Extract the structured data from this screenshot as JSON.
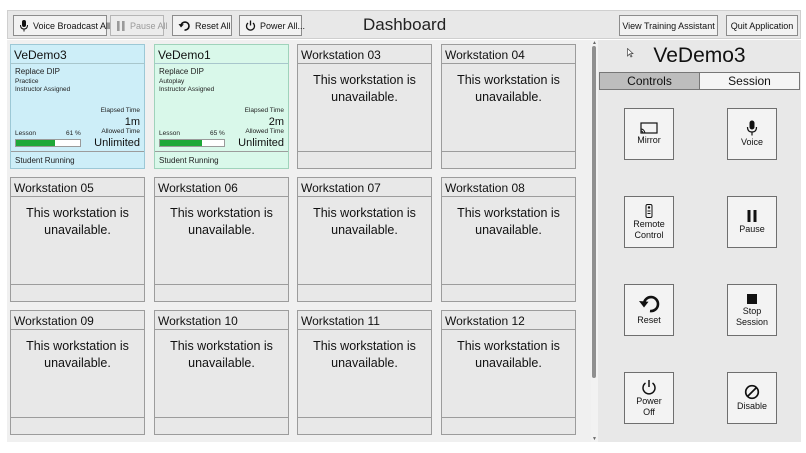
{
  "toolbar": {
    "voice_broadcast": "Voice Broadcast All",
    "pause_all": "Pause All",
    "reset_all": "Reset All",
    "power_all": "Power All...",
    "title": "Dashboard",
    "view_training_assistant": "View Training Assistant",
    "quit_application": "Quit Application"
  },
  "workstations": {
    "vedemo3": {
      "name": "VeDemo3",
      "lesson_title": "Replace DIP",
      "mode": "Practice",
      "assignment": "Instructor Assigned",
      "elapsed_label": "Elapsed Time",
      "elapsed_value": "1m",
      "lesson_label": "Lesson",
      "progress_text": "61 %",
      "progress": 61,
      "allowed_label": "Allowed Time",
      "allowed_value": "Unlimited",
      "status": "Student Running",
      "color": "#cdeef8"
    },
    "vedemo1": {
      "name": "VeDemo1",
      "lesson_title": "Replace DIP",
      "mode": "Autoplay",
      "assignment": "Instructor Assigned",
      "elapsed_label": "Elapsed Time",
      "elapsed_value": "2m",
      "lesson_label": "Lesson",
      "progress_text": "65 %",
      "progress": 65,
      "allowed_label": "Allowed Time",
      "allowed_value": "Unlimited",
      "status": "Student Running",
      "color": "#d9f8ea"
    },
    "unavailable_text": "This workstation is unavailable.",
    "names": {
      "ws03": "Workstation 03",
      "ws04": "Workstation 04",
      "ws05": "Workstation 05",
      "ws06": "Workstation 06",
      "ws07": "Workstation 07",
      "ws08": "Workstation 08",
      "ws09": "Workstation 09",
      "ws10": "Workstation 10",
      "ws11": "Workstation 11",
      "ws12": "Workstation 12"
    }
  },
  "panel": {
    "title": "VeDemo3",
    "tabs": {
      "controls": "Controls",
      "session": "Session"
    },
    "controls": {
      "mirror": "Mirror",
      "voice": "Voice",
      "remote_control": "Remote\nControl",
      "pause": "Pause",
      "reset": "Reset",
      "stop_session": "Stop\nSession",
      "power_off": "Power\nOff",
      "disable": "Disable"
    }
  },
  "colors": {
    "progress": "#1ea838",
    "selected_tab": "#bdbdbd"
  }
}
